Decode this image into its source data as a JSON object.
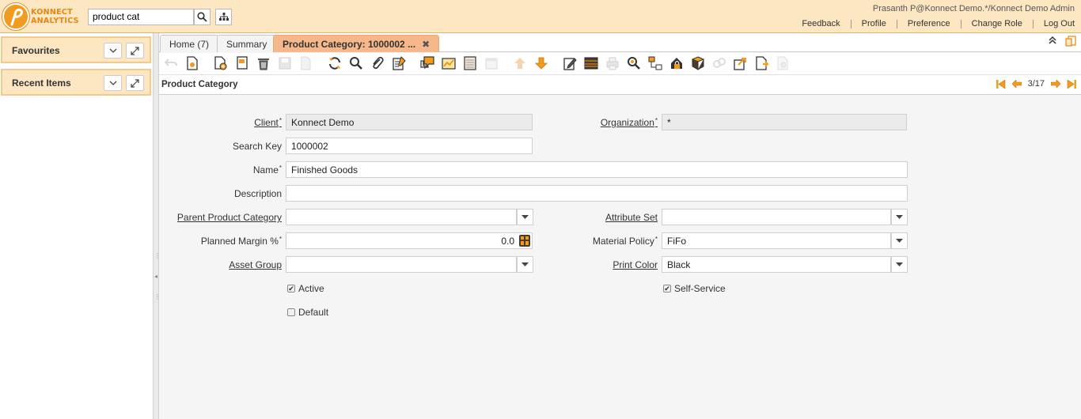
{
  "header": {
    "brand_line1": "KONNECT",
    "brand_line2": "ANALYTICS",
    "search_value": "product cat",
    "user": "Prasanth P@Konnect Demo.*/Konnect Demo Admin",
    "links": [
      "Feedback",
      "Profile",
      "Preference",
      "Change Role",
      "Log Out"
    ]
  },
  "left": {
    "favourites": "Favourites",
    "recent": "Recent Items"
  },
  "tabs": [
    {
      "label": "Home (7)"
    },
    {
      "label": "Summary"
    },
    {
      "label": "Product Category: 1000002 ...",
      "close": "✖"
    }
  ],
  "window": {
    "title": "Product Category",
    "record_nav": "3/17"
  },
  "form": {
    "client": {
      "label": "Client",
      "value": "Konnect Demo"
    },
    "organization": {
      "label": "Organization",
      "value": "*"
    },
    "search_key": {
      "label": "Search Key",
      "value": "1000002"
    },
    "name": {
      "label": "Name",
      "value": "Finished Goods"
    },
    "description": {
      "label": "Description",
      "value": ""
    },
    "parent_category": {
      "label": "Parent Product Category",
      "value": ""
    },
    "attribute_set": {
      "label": "Attribute Set",
      "value": ""
    },
    "planned_margin": {
      "label": "Planned Margin %",
      "value": "0.0"
    },
    "material_policy": {
      "label": "Material Policy",
      "value": "FiFo"
    },
    "asset_group": {
      "label": "Asset Group",
      "value": ""
    },
    "print_color": {
      "label": "Print Color",
      "value": "Black"
    },
    "active": {
      "label": "Active",
      "checked": true
    },
    "self_service": {
      "label": "Self-Service",
      "checked": true
    },
    "default": {
      "label": "Default",
      "checked": false
    }
  },
  "colors": {
    "header_bg": "#fde7c3",
    "accent": "#f29b1e",
    "active_tab": "#f6b88b"
  }
}
